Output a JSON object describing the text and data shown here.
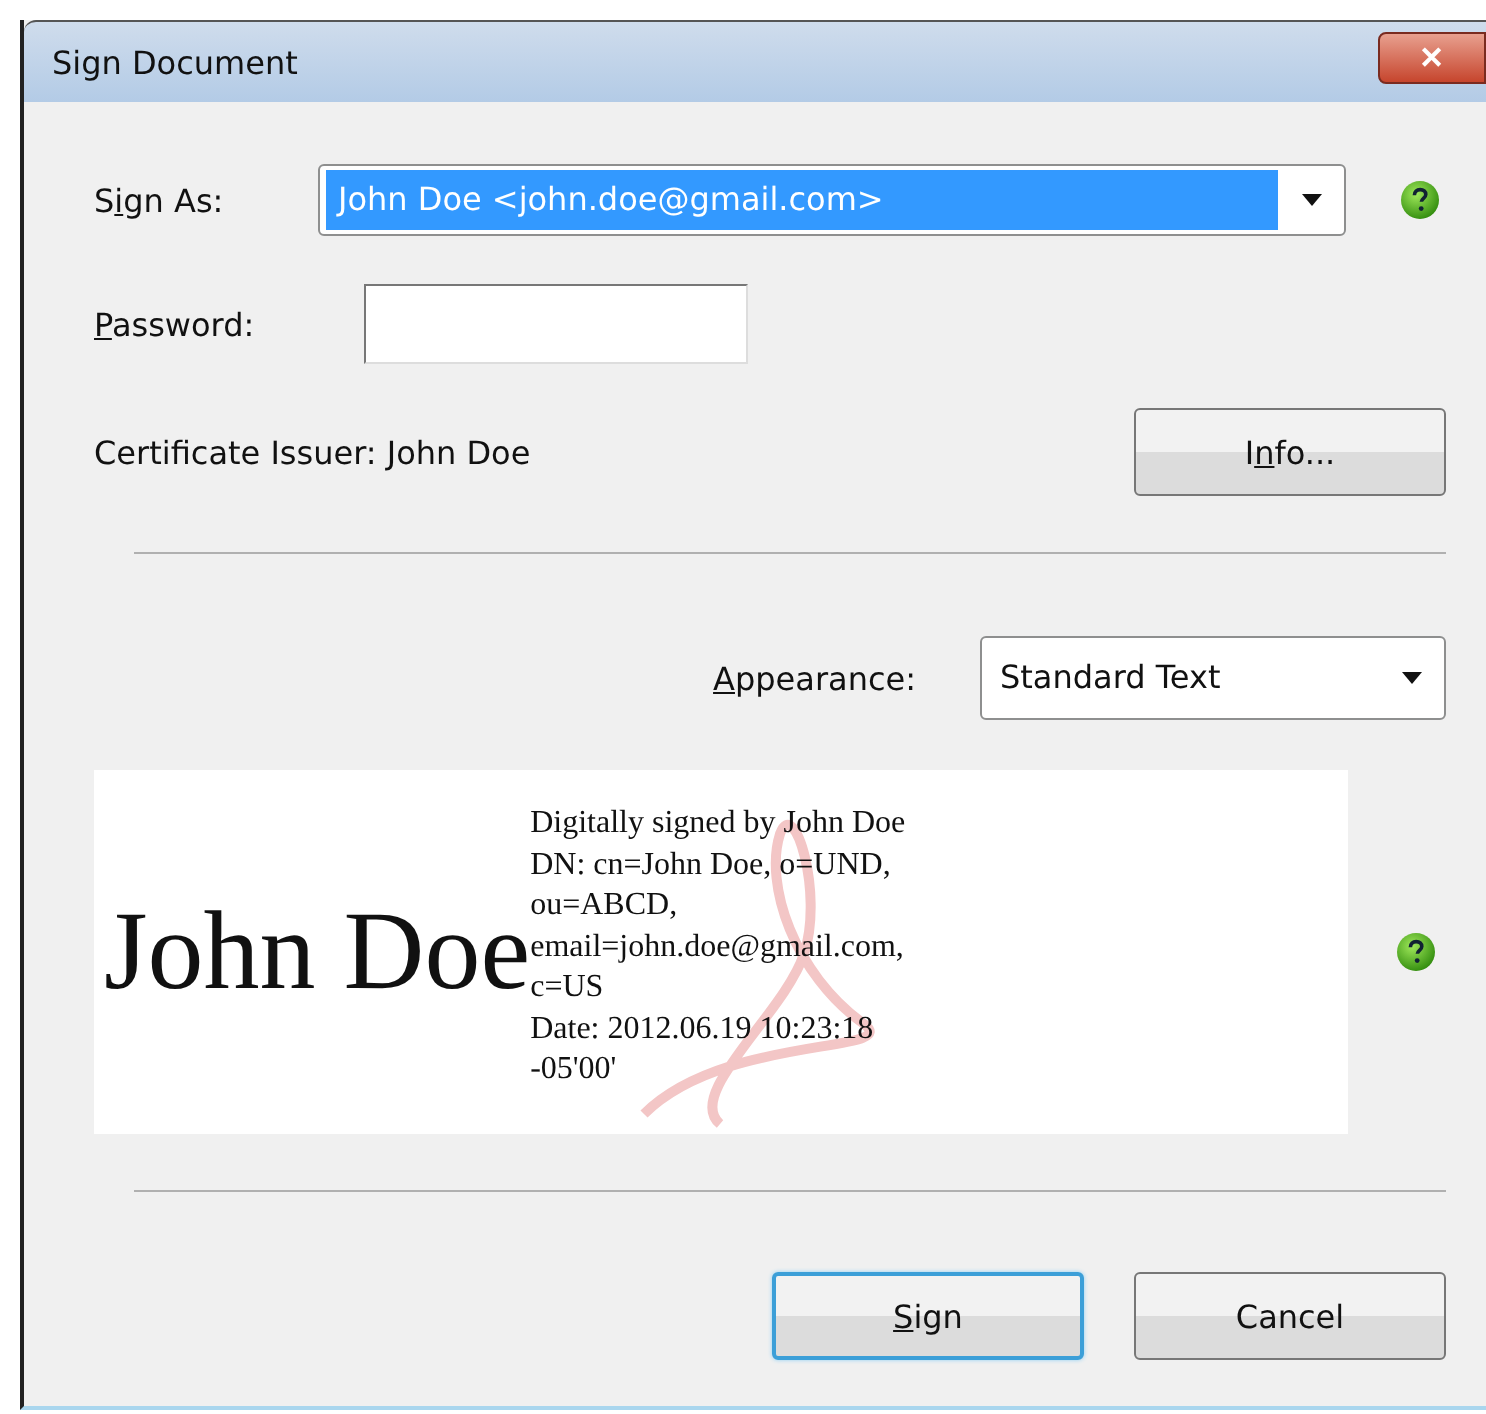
{
  "window": {
    "title": "Sign Document",
    "close": "✕"
  },
  "sign_as": {
    "label": {
      "before": "S",
      "key": "i",
      "after": "gn As:"
    },
    "value": "John Doe <john.doe@gmail.com>",
    "selected": true
  },
  "password": {
    "label": {
      "key": "P",
      "after": "assword:"
    }
  },
  "issuer": "Certificate Issuer: John Doe",
  "info_button": {
    "before": "I",
    "key": "n",
    "after": "fo..."
  },
  "appearance": {
    "label": {
      "key": "A",
      "after": "ppearance:"
    },
    "value": "Standard Text"
  },
  "preview": {
    "name": "John Doe",
    "lines": [
      "Digitally signed by John Doe",
      "DN: cn=John Doe, o=UND,",
      "ou=ABCD,",
      "email=john.doe@gmail.com,",
      "c=US",
      "Date: 2012.06.19 10:23:18",
      "-05'00'"
    ]
  },
  "buttons": [
    {
      "key": "S",
      "after": "ign",
      "default": true
    },
    {
      "before": "Cancel",
      "default": false
    }
  ]
}
